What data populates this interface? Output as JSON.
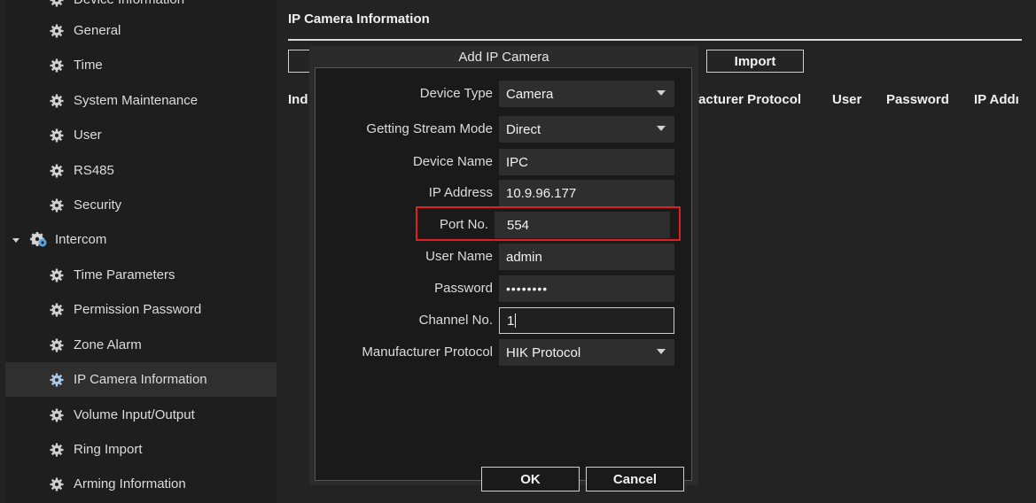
{
  "sidebar": {
    "top_partial": "Device Information",
    "items": [
      {
        "label": "General"
      },
      {
        "label": "Time"
      },
      {
        "label": "System Maintenance"
      },
      {
        "label": "User"
      },
      {
        "label": "RS485"
      },
      {
        "label": "Security"
      }
    ],
    "group": {
      "label": "Intercom"
    },
    "sub_items": [
      {
        "label": "Time Parameters"
      },
      {
        "label": "Permission Password"
      },
      {
        "label": "Zone Alarm"
      },
      {
        "label": "IP Camera Information"
      },
      {
        "label": "Volume Input/Output"
      },
      {
        "label": "Ring Import"
      },
      {
        "label": "Arming Information"
      }
    ]
  },
  "main": {
    "title": "IP Camera Information",
    "import_label": "Import",
    "columns": {
      "index": "Ind",
      "manufacturer_protocol": "ufacturer Protocol",
      "user": "User",
      "password": "Password",
      "ip_address": "IP Addı"
    }
  },
  "dialog": {
    "title": "Add IP Camera",
    "fields": {
      "device_type": {
        "label": "Device Type",
        "value": "Camera"
      },
      "stream_mode": {
        "label": "Getting Stream Mode",
        "value": "Direct"
      },
      "device_name": {
        "label": "Device Name",
        "value": "IPC"
      },
      "ip_address": {
        "label": "IP Address",
        "value": "10.9.96.177"
      },
      "port_no": {
        "label": "Port No.",
        "value": "554"
      },
      "user_name": {
        "label": "User Name",
        "value": "admin"
      },
      "password": {
        "label": "Password",
        "value": "••••••••"
      },
      "channel_no": {
        "label": "Channel No.",
        "value": "1"
      },
      "manufacturer_protocol": {
        "label": "Manufacturer Protocol",
        "value": "HIK Protocol"
      }
    },
    "ok_label": "OK",
    "cancel_label": "Cancel"
  },
  "colors": {
    "background": "#222222",
    "sidebar": "#1e1e1e",
    "active_item": "#2f2f2f",
    "highlight_box": "#e02020",
    "icon_gear": "#d0d0d0",
    "icon_intercom_blue": "#5aa7e8"
  }
}
